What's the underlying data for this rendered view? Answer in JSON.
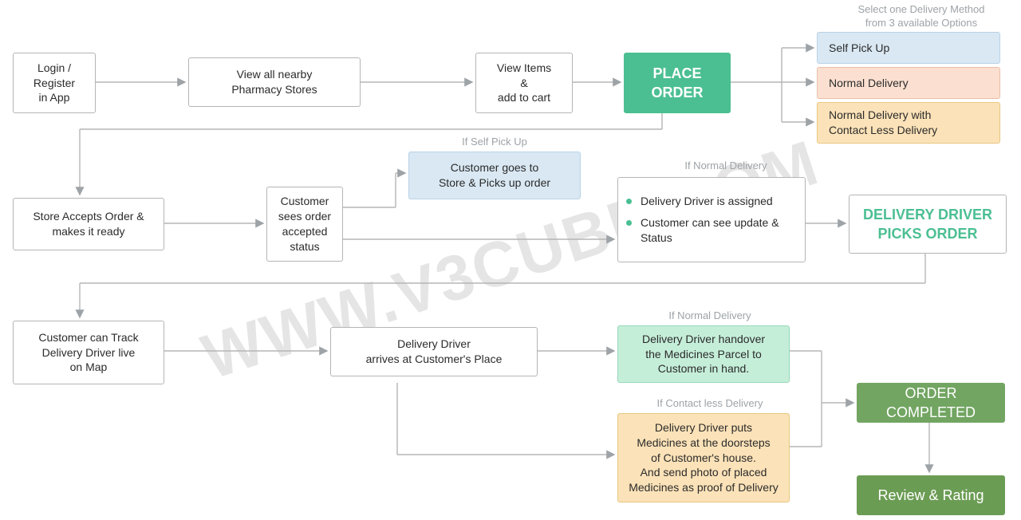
{
  "watermark": "WWW.V3CUBE.COM",
  "header_label": "Select one Delivery Method\nfrom 3 available Options",
  "row1": {
    "login": "Login /\nRegister\nin App",
    "view_stores": "View all nearby\nPharmacy Stores",
    "view_items": "View Items\n&\nadd to cart",
    "place_order": "PLACE\nORDER",
    "opt_self": "Self Pick Up",
    "opt_normal": "Normal Delivery",
    "opt_contactless": "Normal Delivery with\nContact Less Delivery"
  },
  "row2": {
    "store_accepts": "Store Accepts Order &\nmakes it ready",
    "status": "Customer\nsees order\naccepted\nstatus",
    "self_pickup_label": "If Self Pick Up",
    "self_pickup_box": "Customer goes to\nStore & Picks up order",
    "normal_delivery_label": "If Normal Delivery",
    "bullets": [
      "Delivery Driver is assigned",
      "Customer can see update & Status"
    ],
    "driver_picks": "DELIVERY DRIVER\nPICKS ORDER"
  },
  "row3": {
    "track": "Customer can Track\nDelivery Driver live\non Map",
    "arrives": "Delivery Driver\narrives at Customer's Place",
    "normal_label": "If Normal Delivery",
    "handover": "Delivery Driver handover\nthe Medicines Parcel to\nCustomer in hand.",
    "contactless_label": "If Contact less Delivery",
    "doorstep": "Delivery Driver puts\nMedicines at the doorsteps\nof Customer's house.\nAnd send photo of placed\nMedicines as proof of Delivery",
    "order_completed": "ORDER COMPLETED",
    "review": "Review & Rating"
  }
}
